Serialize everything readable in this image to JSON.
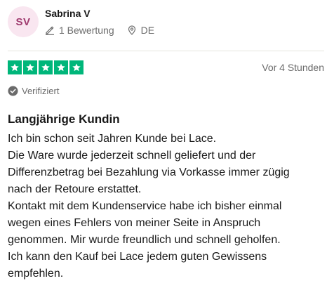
{
  "reviewer": {
    "initials": "SV",
    "name": "Sabrina V",
    "reviews_count": "1 Bewertung",
    "country": "DE"
  },
  "review": {
    "rating": 5,
    "rating_max": 5,
    "date": "Vor 4 Stunden",
    "verified_label": "Verifiziert",
    "title": "Langjährige Kundin",
    "body_lines": [
      "Ich bin schon seit Jahren Kunde bei Lace.",
      "Die Ware wurde jederzeit schnell geliefert und der",
      "Differenzbetrag bei Bezahlung via Vorkasse immer zügig",
      "nach der Retoure erstattet.",
      "Kontakt mit dem Kundenservice habe ich bisher einmal",
      "wegen eines Fehlers von meiner Seite in Anspruch",
      "genommen. Mir wurde freundlich und schnell geholfen.",
      "Ich kann den Kauf bei Lace jedem guten Gewissens",
      "empfehlen."
    ]
  },
  "colors": {
    "star_green": "#00b67a",
    "avatar_bg": "#f9e6f0",
    "avatar_text": "#9f3a6e",
    "muted_text": "#6b6b6b"
  },
  "icons": {
    "reviews": "pencil-icon",
    "location": "location-pin-icon",
    "verified": "verified-check-icon",
    "star": "star-icon"
  }
}
